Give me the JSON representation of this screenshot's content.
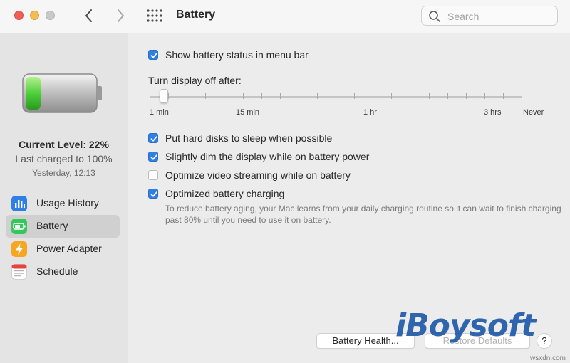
{
  "window": {
    "title": "Battery"
  },
  "search": {
    "placeholder": "Search"
  },
  "sidebar": {
    "current_level": "Current Level: 22%",
    "last_charged": "Last charged to 100%",
    "timestamp": "Yesterday, 12:13",
    "battery_level": 0.22,
    "items": [
      {
        "label": "Usage History",
        "icon": "bar-chart-icon",
        "color": "#2f7fe4"
      },
      {
        "label": "Battery",
        "icon": "battery-icon",
        "color": "#34c759"
      },
      {
        "label": "Power Adapter",
        "icon": "lightning-icon",
        "color": "#f5a623"
      },
      {
        "label": "Schedule",
        "icon": "calendar-icon",
        "color": "#ffffff"
      }
    ]
  },
  "main": {
    "show_status": {
      "label": "Show battery status in menu bar",
      "checked": true
    },
    "display_off": {
      "label": "Turn display off after:",
      "ticks": [
        "1 min",
        "15 min",
        "1 hr",
        "3 hrs",
        "Never"
      ],
      "value": "1 min"
    },
    "options": [
      {
        "label": "Put hard disks to sleep when possible",
        "checked": true
      },
      {
        "label": "Slightly dim the display while on battery power",
        "checked": true
      },
      {
        "label": "Optimize video streaming while on battery",
        "checked": false
      },
      {
        "label": "Optimized battery charging",
        "checked": true
      }
    ],
    "description": "To reduce battery aging, your Mac learns from your daily charging routine so it can wait to finish charging past 80% until you need to use it on battery."
  },
  "buttons": {
    "health": "Battery Health...",
    "restore": "Restore Defaults",
    "help": "?"
  },
  "overlay": {
    "logo": "iBoysoft",
    "watermark": "wsxdn.com"
  },
  "colors": {
    "accent": "#2f7fe4",
    "battery_fill": "#34c759"
  }
}
